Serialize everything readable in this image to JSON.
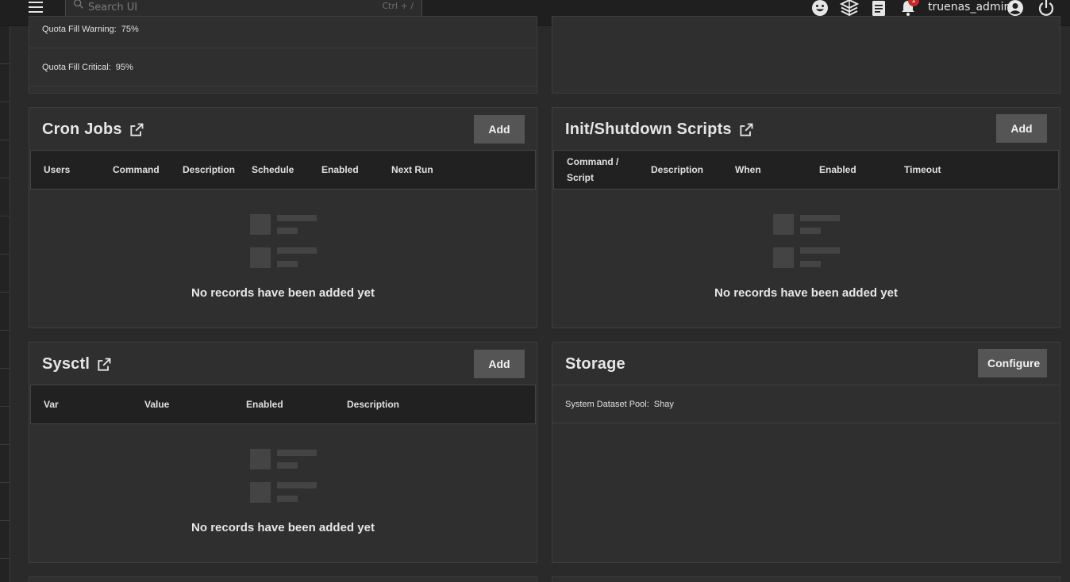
{
  "topbar": {
    "search_placeholder": "Search UI",
    "search_shortcut": "Ctrl + /",
    "notification_count": "1",
    "username": "truenas_admin",
    "icons": [
      "menu-icon",
      "search-icon",
      "smiley-icon",
      "truecommand-icon",
      "clipboard-icon",
      "bell-icon",
      "account-icon",
      "power-icon"
    ]
  },
  "top_card": {
    "quota_warning_label": "Quota Fill Warning:",
    "quota_warning_value": "75%",
    "quota_critical_label": "Quota Fill Critical:",
    "quota_critical_value": "95%"
  },
  "cron": {
    "title": "Cron Jobs",
    "add_label": "Add",
    "columns": [
      "Users",
      "Command",
      "Description",
      "Schedule",
      "Enabled",
      "Next Run"
    ],
    "empty_text": "No records have been added yet"
  },
  "init": {
    "title": "Init/Shutdown Scripts",
    "add_label": "Add",
    "columns": [
      "Command / Script",
      "Description",
      "When",
      "Enabled",
      "Timeout"
    ],
    "empty_text": "No records have been added yet"
  },
  "sysctl": {
    "title": "Sysctl",
    "add_label": "Add",
    "columns": [
      "Var",
      "Value",
      "Enabled",
      "Description"
    ],
    "empty_text": "No records have been added yet"
  },
  "storage": {
    "title": "Storage",
    "configure_label": "Configure",
    "dataset_pool_label": "System Dataset Pool:",
    "dataset_pool_value": "Shay"
  },
  "colors": {
    "background": "#2a2a2a",
    "card": "#2f2f2f",
    "button": "#555555",
    "badge": "#c62828"
  }
}
